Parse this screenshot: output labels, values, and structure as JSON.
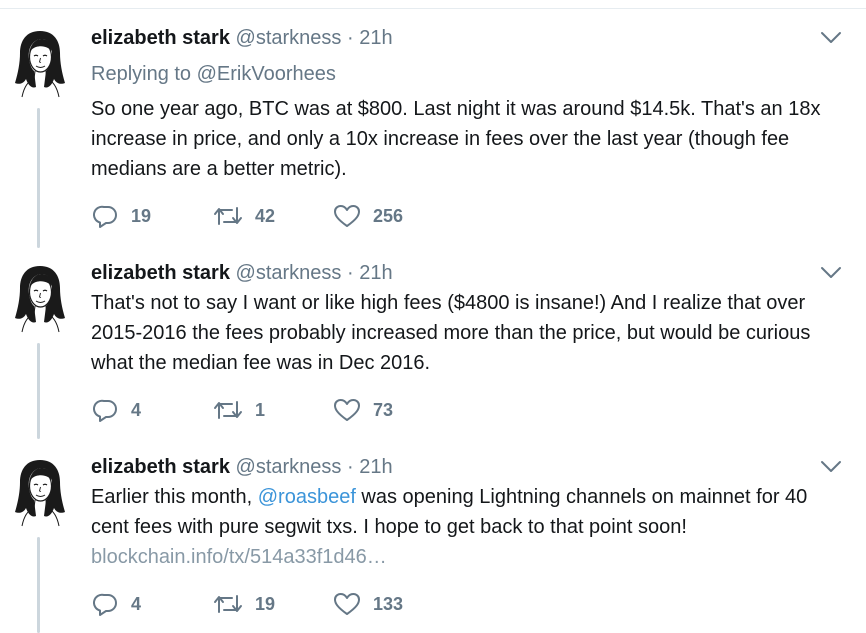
{
  "tweets": [
    {
      "author_name": "elizabeth stark",
      "handle": "@starkness",
      "separator": "·",
      "time": "21h",
      "replying_prefix": "Replying to",
      "replying_to": "@ErikVoorhees",
      "text": "So one year ago, BTC was at $800. Last night it was around $14.5k. That's an 18x increase in price, and only a 10x increase in fees over the last year (though fee medians are a better metric).",
      "replies": "19",
      "retweets": "42",
      "likes": "256"
    },
    {
      "author_name": "elizabeth stark",
      "handle": "@starkness",
      "separator": "·",
      "time": "21h",
      "text": "That's not to say I want or like high fees ($4800 is insane!) And I realize that over 2015-2016 the fees probably increased more than the price, but would be curious what the median fee was in Dec 2016.",
      "replies": "4",
      "retweets": "1",
      "likes": "73"
    },
    {
      "author_name": "elizabeth stark",
      "handle": "@starkness",
      "separator": "·",
      "time": "21h",
      "text_before": "Earlier this month, ",
      "mention": "@roasbeef",
      "text_after": " was opening Lightning channels on mainnet for 40 cent fees with pure segwit txs. I hope to get back to that point soon!",
      "link": "blockchain.info/tx/514a33f1d46…",
      "replies": "4",
      "retweets": "19",
      "likes": "133"
    }
  ],
  "icons": {
    "reply": "reply-icon",
    "retweet": "retweet-icon",
    "like": "heart-icon",
    "menu": "chevron-down-icon",
    "avatar": "avatar-sketch"
  },
  "colors": {
    "name": "#14171a",
    "secondary": "#657786",
    "mention": "#3b94d9",
    "link": "#8899a6",
    "thread_line": "#ccd6dd"
  }
}
